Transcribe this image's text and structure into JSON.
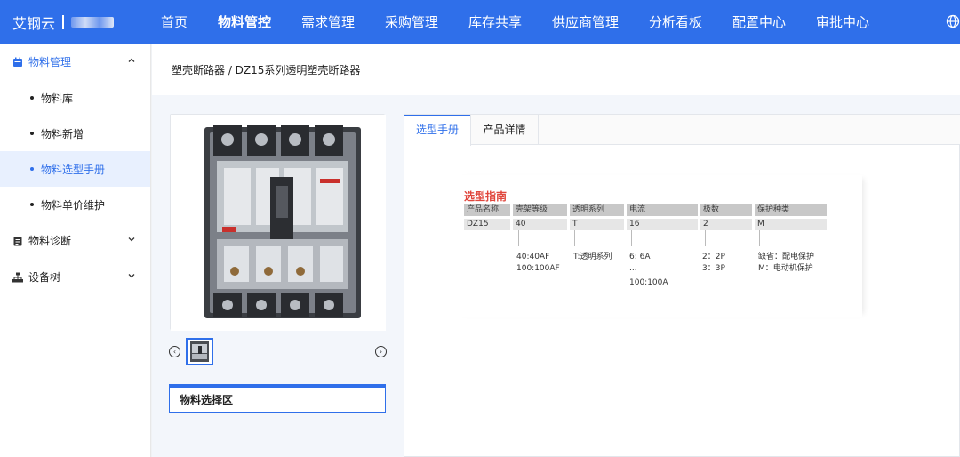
{
  "app": {
    "logo_text": "艾钢云"
  },
  "nav": {
    "items": [
      "首页",
      "物料管控",
      "需求管理",
      "采购管理",
      "库存共享",
      "供应商管理",
      "分析看板",
      "配置中心",
      "审批中心"
    ],
    "active_index": 1
  },
  "sidebar": {
    "groups": [
      {
        "label": "物料管理",
        "icon": "calendar-icon",
        "open": true
      },
      {
        "label": "物料诊断",
        "icon": "clipboard-icon",
        "open": false
      },
      {
        "label": "设备树",
        "icon": "org-tree-icon",
        "open": false
      }
    ],
    "sub_items": [
      "物料库",
      "物料新增",
      "物料选型手册",
      "物料单价维护"
    ],
    "active_sub": "物料选型手册"
  },
  "breadcrumb": "塑壳断路器 / DZ15系列透明塑壳断路器",
  "tabs": [
    "选型手册",
    "产品详情"
  ],
  "active_tab": "选型手册",
  "selection_area_label": "物料选择区",
  "guide": {
    "title": "选型指南",
    "headers": [
      "产品名称",
      "壳架等级",
      "透明系列",
      "电流",
      "极数",
      "保护种类"
    ],
    "values": [
      "DZ15",
      "40",
      "T",
      "16",
      "2",
      "M"
    ],
    "options": {
      "frame": [
        "40:40AF",
        "100:100AF"
      ],
      "series": [
        "T:透明系列"
      ],
      "current": [
        "6: 6A",
        "...",
        "100:100A"
      ],
      "poles": [
        "2：2P",
        "3：3P"
      ],
      "protection": [
        "缺省：配电保护",
        "M：电动机保护"
      ]
    }
  },
  "colors": {
    "primary": "#2f6fea",
    "guide_title": "#e0463c"
  }
}
